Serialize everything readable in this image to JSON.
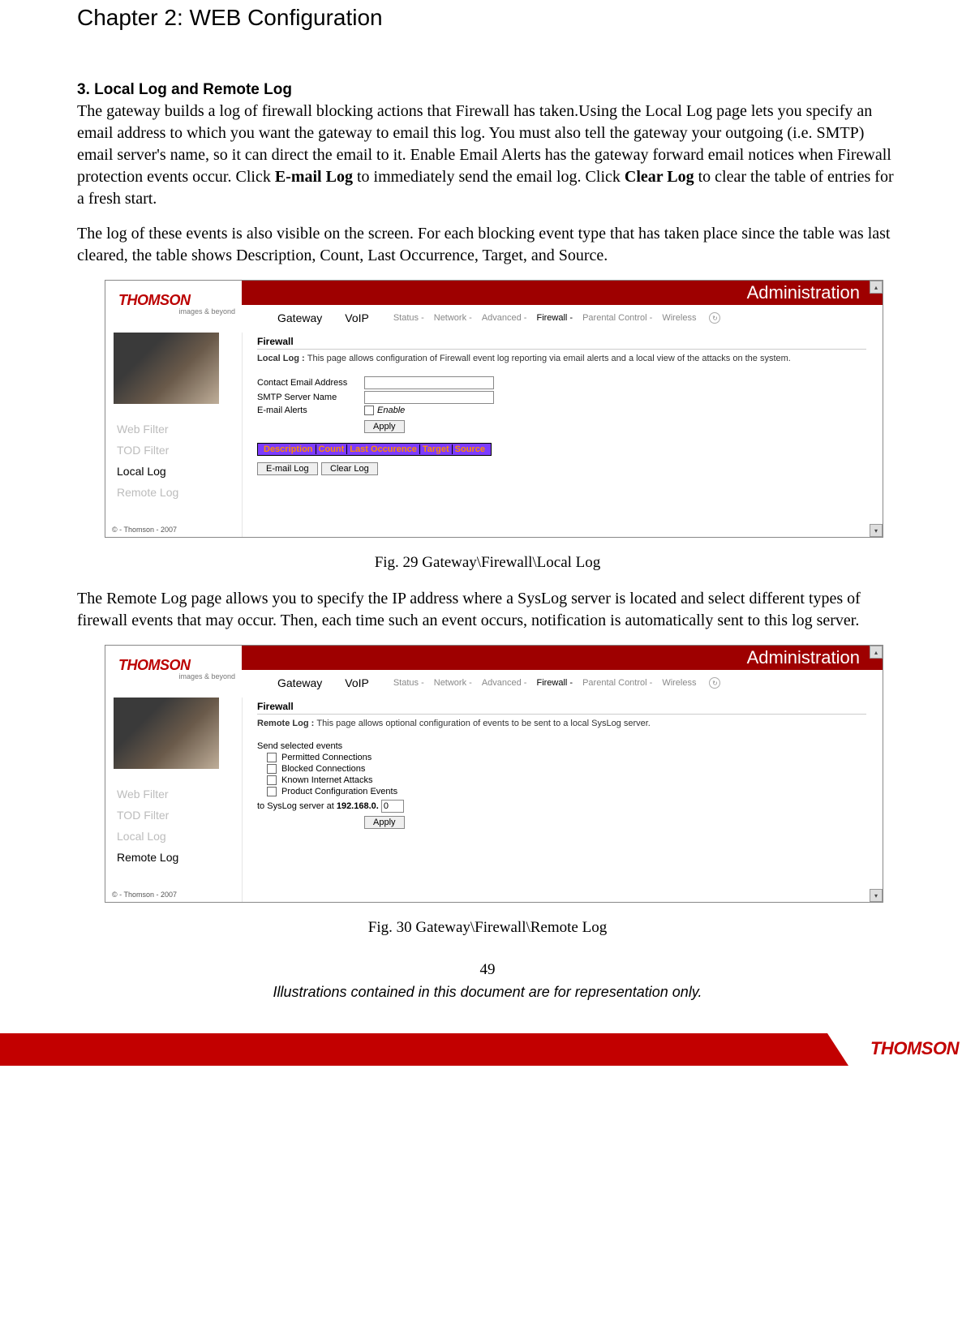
{
  "chapter_title": "Chapter 2: WEB Configuration",
  "section_title": "3. Local Log and Remote Log",
  "para1_pre": "The gateway builds a log of firewall blocking actions that Firewall has taken.Using the Local Log page lets you specify an email address to which you want the gateway to email this log. You must also tell the gateway your outgoing (i.e. SMTP) email server's name, so it can direct the email to it. Enable Email Alerts has the gateway forward email notices when Firewall protection events occur. Click ",
  "para1_b1": "E-mail Log",
  "para1_mid": " to immediately send the email log. Click ",
  "para1_b2": "Clear Log",
  "para1_post": " to clear the table of entries for a fresh start.",
  "para2": "The log of these events is also visible on the screen. For each blocking event type that has taken place since the table was last cleared, the table shows Description, Count, Last Occurrence, Target, and Source.",
  "fig1_caption": "Fig. 29 Gateway\\Firewall\\Local Log",
  "para3": "The Remote Log page allows you to specify the IP address where a SysLog server is located and select different types of firewall events that may occur. Then, each time such an event occurs, notification is automatically sent to this log server.",
  "fig2_caption": "Fig. 30 Gateway\\Firewall\\Remote Log",
  "page_num": "49",
  "disclaimer": "Illustrations contained in this document are for representation only.",
  "footer_brand": "THOMSON",
  "ss": {
    "logo": "THOMSON",
    "logo_tag": "images & beyond",
    "banner": "Administration",
    "nav_main": [
      "Gateway",
      "VoIP"
    ],
    "nav_sub": [
      "Status -",
      "Network -",
      "Advanced -",
      "Firewall -",
      "Parental Control -",
      "Wireless"
    ],
    "nav_active": "Firewall -",
    "side_items": [
      "Web Filter",
      "TOD Filter",
      "Local Log",
      "Remote Log"
    ],
    "copy": "© - Thomson - 2007",
    "fw_title": "Firewall",
    "local": {
      "active": "Local Log",
      "desc_b": "Local Log : ",
      "desc": "This page allows configuration of Firewall event log reporting via email alerts and a local view of the attacks on the system.",
      "rows": {
        "email": "Contact Email Address",
        "smtp": "SMTP Server Name",
        "alerts": "E-mail Alerts",
        "enable": "Enable"
      },
      "btn_apply": "Apply",
      "tbl": [
        "Description",
        "Count",
        "Last Occurence",
        "Target",
        "Source"
      ],
      "btn_email": "E-mail Log",
      "btn_clear": "Clear Log"
    },
    "remote": {
      "active": "Remote Log",
      "desc_b": "Remote Log : ",
      "desc": "This page allows optional configuration of events to be sent to a local SysLog server.",
      "send_label": "Send selected events",
      "opts": [
        "Permitted Connections",
        "Blocked Connections",
        "Known Internet Attacks",
        "Product Configuration Events"
      ],
      "syslog_pre": "to SysLog server at ",
      "syslog_ip": "192.168.0.",
      "syslog_val": "0",
      "btn_apply": "Apply"
    }
  }
}
